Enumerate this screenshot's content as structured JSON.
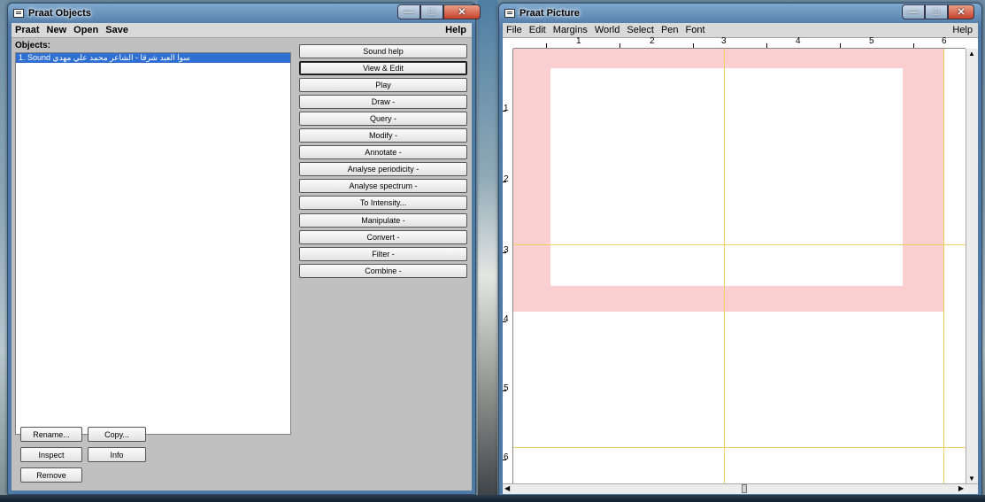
{
  "objects_window": {
    "title": "Praat Objects",
    "menu": [
      "Praat",
      "New",
      "Open",
      "Save"
    ],
    "help": "Help",
    "objects_label": "Objects:",
    "list_items": [
      "1. Sound سوا العبد شرقا - الشاعر محمد علي مهدي"
    ],
    "actions": [
      "Sound help",
      "View & Edit",
      "Play",
      "Draw -",
      "Query -",
      "Modify -",
      "Annotate -",
      "Analyse periodicity -",
      "Analyse spectrum -",
      "To Intensity...",
      "Manipulate -",
      "Convert -",
      "Filter -",
      "Combine -"
    ],
    "bottom_buttons": {
      "rename": "Rename...",
      "copy": "Copy...",
      "inspect": "Inspect",
      "info": "Info",
      "remove": "Remove"
    }
  },
  "picture_window": {
    "title": "Praat Picture",
    "menu": [
      "File",
      "Edit",
      "Margins",
      "World",
      "Select",
      "Pen",
      "Font"
    ],
    "help": "Help",
    "ruler_x": [
      "1",
      "2",
      "3",
      "4",
      "5",
      "6"
    ],
    "ruler_y": [
      "1",
      "2",
      "3",
      "4",
      "5",
      "6"
    ]
  },
  "colors": {
    "selection": "#f9cfcf",
    "guide_lines": "#f0d060",
    "list_highlight": "#2f6fd1"
  }
}
